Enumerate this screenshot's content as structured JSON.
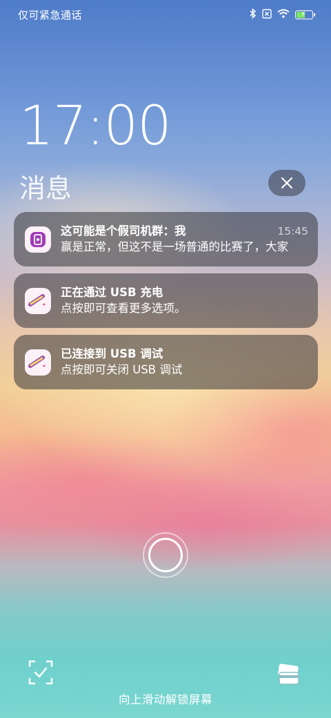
{
  "status_bar": {
    "carrier_text": "仅可紧急通话",
    "icons": [
      "bluetooth-icon",
      "no-sim-icon",
      "wifi-icon",
      "battery-charging-icon"
    ],
    "battery_level": 0.55
  },
  "clock": {
    "time": "17:00"
  },
  "notifications_header": {
    "title": "消息",
    "clear_icon": "close-icon"
  },
  "notifications": [
    {
      "title": "这可能是个假司机群：我",
      "body": "赢是正常，但这不是一场普通的比赛了，大家",
      "time": "15:45",
      "icon": "phone-app-icon"
    },
    {
      "title": "正在通过 USB 充电",
      "body": "点按即可查看更多选项。",
      "time": "",
      "icon": "usb-cable-icon"
    },
    {
      "title": "已连接到 USB 调试",
      "body": "点按即可关闭 USB 调试",
      "time": "",
      "icon": "usb-cable-icon"
    }
  ],
  "bottom": {
    "hint": "向上滑动解锁屏幕",
    "left_icon": "scan-icon",
    "right_icon": "cards-icon"
  },
  "colors": {
    "sky_top": "#4f7cc8",
    "sea_bottom": "#7ad6d1",
    "card_bg": "rgba(55,55,60,0.55)",
    "icon_purple": "#a23bb8"
  }
}
